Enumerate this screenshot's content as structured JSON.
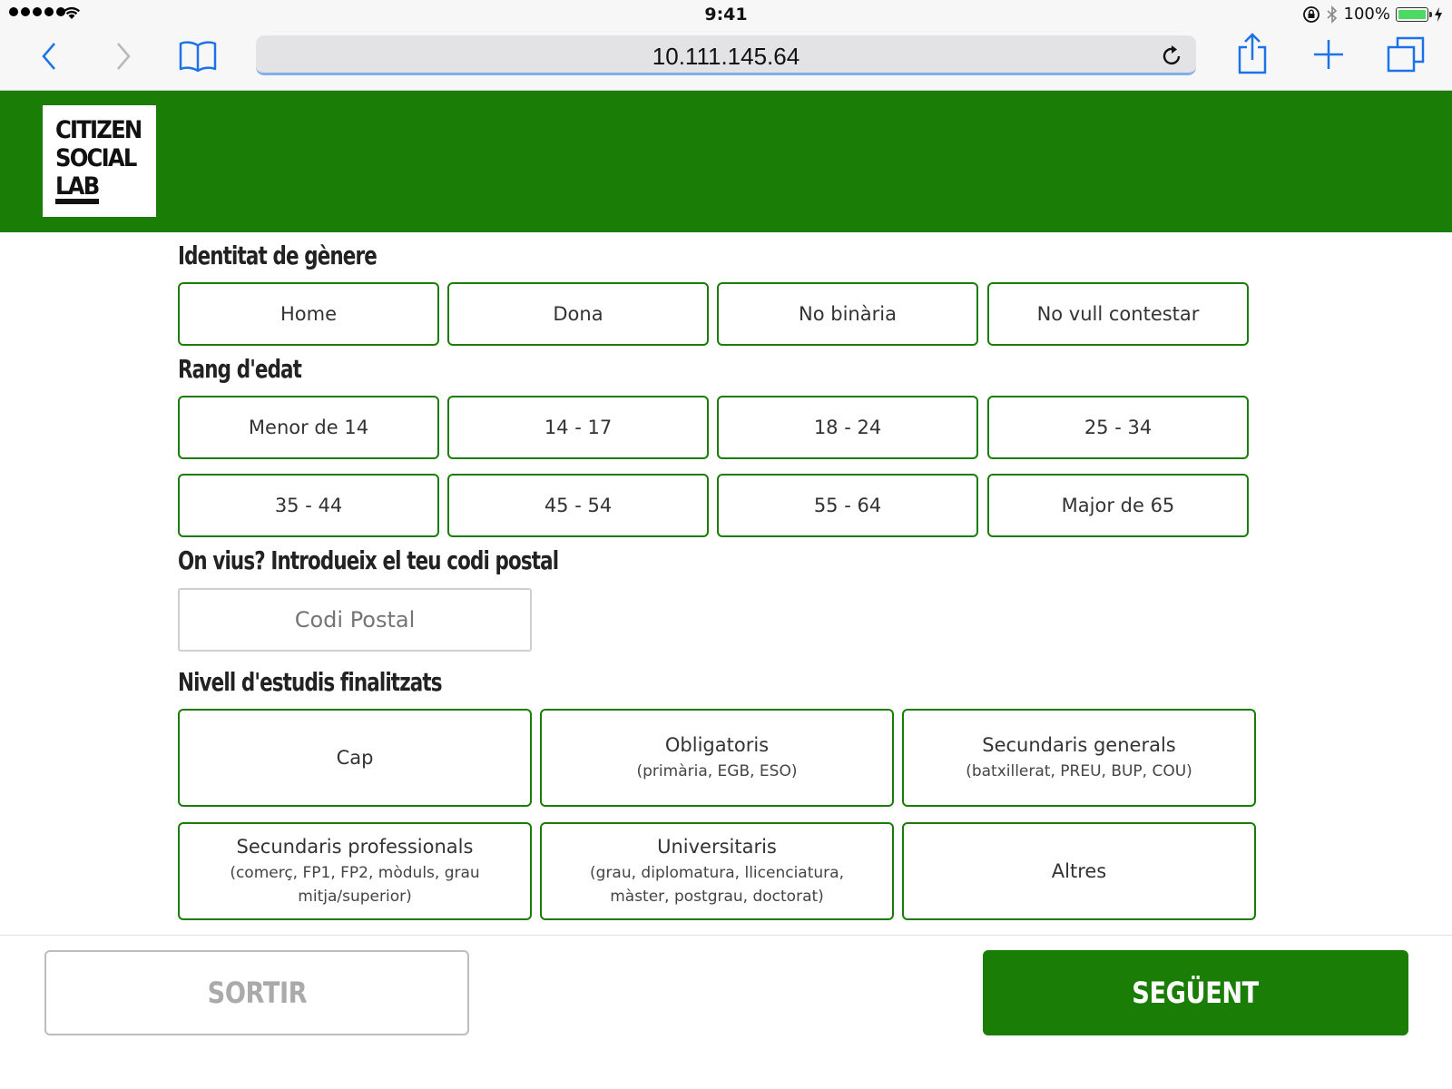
{
  "status_bar": {
    "time": "9:41",
    "battery": "100%",
    "battery_level": 1.0
  },
  "browser": {
    "url": "10.111.145.64",
    "icons": [
      "back-icon",
      "forward-icon",
      "bookmarks-icon",
      "reload-icon",
      "share-icon",
      "new-tab-icon",
      "tabs-icon"
    ]
  },
  "header": {
    "logo_lines": [
      "CITIZEN",
      "SOCIAL",
      "LAB"
    ],
    "color": "#1a7d05"
  },
  "gender": {
    "title": "Identitat de gènere",
    "options": [
      "Home",
      "Dona",
      "No binària",
      "No vull contestar"
    ]
  },
  "age": {
    "title": "Rang d'edat",
    "options": [
      "Menor de 14",
      "14 - 17",
      "18 - 24",
      "25 - 34",
      "35 - 44",
      "45 - 54",
      "55 - 64",
      "Major de 65"
    ]
  },
  "postal": {
    "title": "On vius? Introdueix el teu codi postal",
    "placeholder": "Codi Postal"
  },
  "studies": {
    "title": "Nivell d'estudis finalitzats",
    "options": [
      {
        "label": "Cap",
        "detail": ""
      },
      {
        "label": "Obligatoris",
        "detail": "(primària, EGB, ESO)"
      },
      {
        "label": "Secundaris generals",
        "detail": "(batxillerat, PREU, BUP, COU)"
      },
      {
        "label": "Secundaris professionals",
        "detail": "(comerç, FP1, FP2, mòduls, grau mitja/superior)"
      },
      {
        "label": "Universitaris",
        "detail": "(grau, diplomatura, llicenciatura, màster, postgrau, doctorat)"
      },
      {
        "label": "Altres",
        "detail": ""
      }
    ]
  },
  "footer": {
    "exit_label": "SORTIR",
    "next_label": "SEGÜENT"
  }
}
